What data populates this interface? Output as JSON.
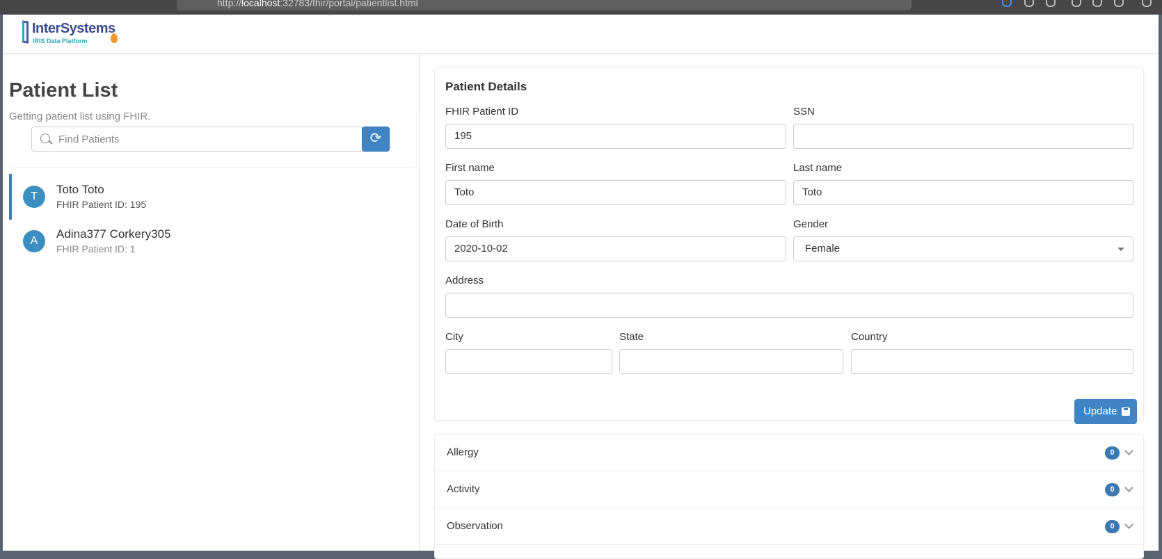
{
  "browser": {
    "url_prefix": "http://",
    "url_host": "localhost",
    "url_rest": ":32783/fhir/portal/patientlist.html"
  },
  "header": {
    "logo_name": "InterSystems",
    "logo_sub": "IRIS Data Platform"
  },
  "left": {
    "title": "Patient List",
    "subtitle": "Getting patient list using FHIR.",
    "search_placeholder": "Find Patients",
    "refresh_icon": "refresh-icon",
    "patients": [
      {
        "initial": "T",
        "name": "Toto Toto",
        "id_text": "FHIR Patient ID: 195",
        "active": true
      },
      {
        "initial": "A",
        "name": "Adina377 Corkery305",
        "id_text": "FHIR Patient ID: 1",
        "active": false
      }
    ]
  },
  "details": {
    "title": "Patient Details",
    "fields": {
      "fhir_id": {
        "label": "FHIR Patient ID",
        "value": "195"
      },
      "ssn": {
        "label": "SSN",
        "value": ""
      },
      "first_name": {
        "label": "First name",
        "value": "Toto"
      },
      "last_name": {
        "label": "Last name",
        "value": "Toto"
      },
      "dob": {
        "label": "Date of Birth",
        "value": "2020-10-02"
      },
      "gender": {
        "label": "Gender",
        "value": "Female"
      },
      "address": {
        "label": "Address",
        "value": ""
      },
      "city": {
        "label": "City",
        "value": ""
      },
      "state": {
        "label": "State",
        "value": ""
      },
      "country": {
        "label": "Country",
        "value": ""
      }
    },
    "update_label": "Update"
  },
  "accordion": [
    {
      "label": "Allergy",
      "count": "0"
    },
    {
      "label": "Activity",
      "count": "0"
    },
    {
      "label": "Observation",
      "count": "0"
    }
  ],
  "colors": {
    "primary": "#3f85c6",
    "avatar": "#3a8fc0",
    "badge": "#3a78b0"
  }
}
